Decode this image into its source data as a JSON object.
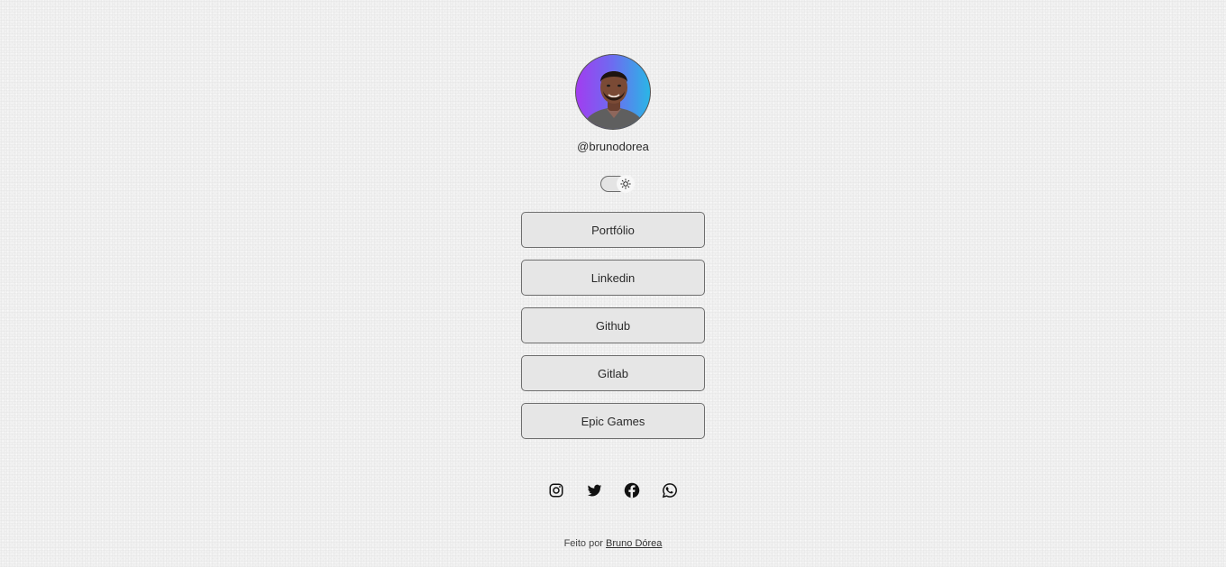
{
  "profile": {
    "username": "@brunodorea",
    "avatar_colors": [
      "#a23cf0",
      "#2ab6e6"
    ]
  },
  "theme_toggle": {
    "icon": "sun-icon"
  },
  "links": [
    {
      "label": "Portfólio"
    },
    {
      "label": "Linkedin"
    },
    {
      "label": "Github"
    },
    {
      "label": "Gitlab"
    },
    {
      "label": "Epic Games"
    }
  ],
  "socials": [
    {
      "icon": "instagram-icon"
    },
    {
      "icon": "twitter-icon"
    },
    {
      "icon": "facebook-icon"
    },
    {
      "icon": "whatsapp-icon"
    }
  ],
  "footer": {
    "prefix": "Feito por",
    "author": "Bruno Dórea"
  }
}
